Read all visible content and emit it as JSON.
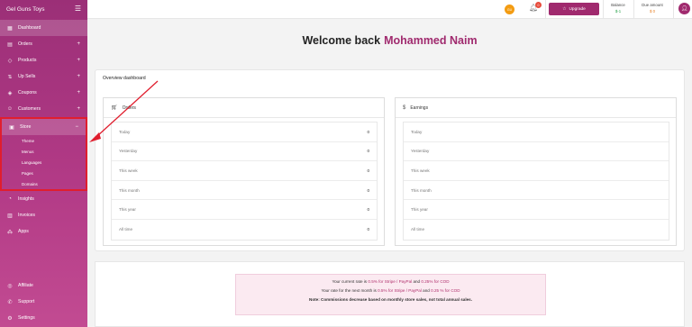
{
  "brand": "Gel Guns Toys",
  "sidebar": {
    "items": [
      {
        "label": "Dashboard",
        "icon": "dashboard-icon",
        "expandable": false,
        "active": true
      },
      {
        "label": "Orders",
        "icon": "orders-icon",
        "expandable": true
      },
      {
        "label": "Products",
        "icon": "products-icon",
        "expandable": true
      },
      {
        "label": "Up Sells",
        "icon": "upsells-icon",
        "expandable": true
      },
      {
        "label": "Coupons",
        "icon": "coupons-icon",
        "expandable": true
      },
      {
        "label": "Customers",
        "icon": "customers-icon",
        "expandable": true
      }
    ],
    "store": {
      "label": "Store",
      "icon": "store-icon",
      "toggle": "−",
      "subitems": [
        "Theme",
        "Menus",
        "Languages",
        "Pages",
        "Domains"
      ]
    },
    "items_after": [
      {
        "label": "Insights",
        "icon": "insights-icon"
      },
      {
        "label": "Invoices",
        "icon": "invoices-icon"
      },
      {
        "label": "Apps",
        "icon": "apps-icon"
      }
    ],
    "bottom": [
      {
        "label": "Affiliate",
        "icon": "affiliate-icon"
      },
      {
        "label": "Support",
        "icon": "support-icon"
      },
      {
        "label": "Settings",
        "icon": "settings-icon"
      }
    ],
    "plus_symbol": "+"
  },
  "header": {
    "user_initials": "GU",
    "notification_count": "0",
    "upgrade_label": "Upgrade",
    "balance_label": "Balance",
    "balance_value": "$-1",
    "due_label": "Due amount",
    "due_value": "$ 0"
  },
  "main": {
    "welcome_text": "Welcome back",
    "user_name": "Mohammed Naim",
    "overview_title": "Overview dashboard",
    "orders_card": {
      "title": "Orders",
      "rows": [
        {
          "label": "Today",
          "value": "0"
        },
        {
          "label": "Yesterday",
          "value": "0"
        },
        {
          "label": "This week",
          "value": "0"
        },
        {
          "label": "This month",
          "value": "0"
        },
        {
          "label": "This year",
          "value": "0"
        },
        {
          "label": "All time",
          "value": "0"
        }
      ]
    },
    "earnings_card": {
      "title": "Earnings",
      "rows": [
        {
          "label": "Today",
          "value": ""
        },
        {
          "label": "Yesterday",
          "value": ""
        },
        {
          "label": "This week",
          "value": ""
        },
        {
          "label": "This month",
          "value": ""
        },
        {
          "label": "This year",
          "value": ""
        },
        {
          "label": "All time",
          "value": ""
        }
      ]
    },
    "rates": {
      "line1_pre": "Your current rate is",
      "line1_rate1": "0.5% for Stripe / PayPal",
      "line1_mid": "and",
      "line1_rate2": "0.25% for COD",
      "line2_pre": "Your rate for the next month is",
      "line2_rate1": "0.5% for Stripe / PayPal",
      "line2_mid": "and",
      "line2_rate2": "0.25 % for COD",
      "note": "Note: Commissions decrease based on monthly store sales, not total annual sales."
    }
  },
  "colors": {
    "accent": "#a02a6e",
    "annotation": "#e01e2e"
  }
}
